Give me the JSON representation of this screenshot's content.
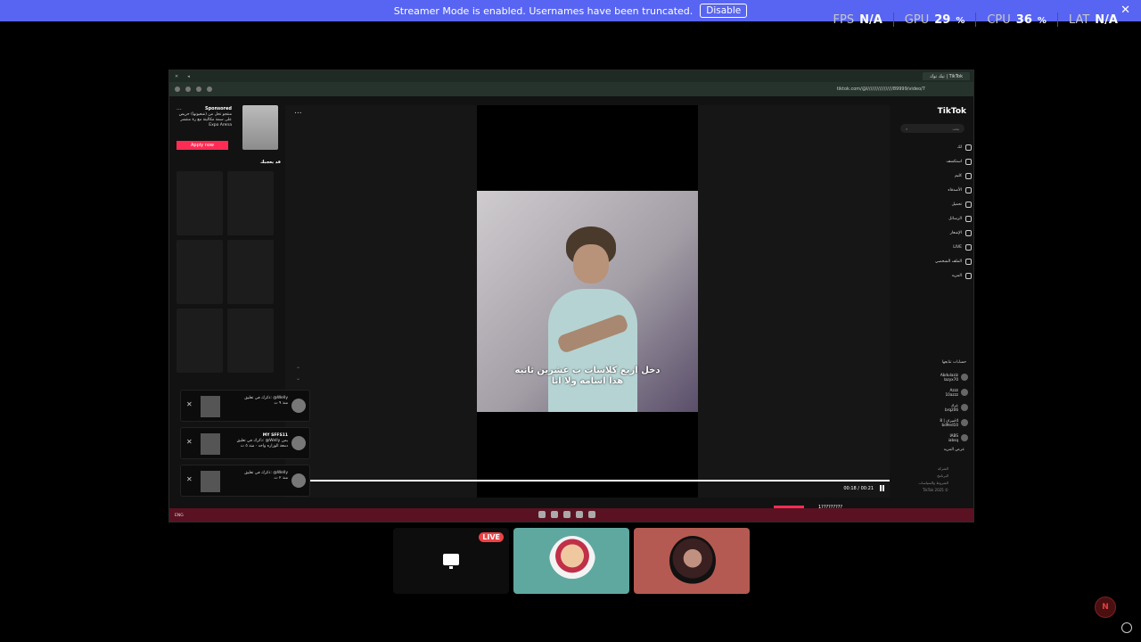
{
  "banner": {
    "message": "Streamer Mode is enabled. Usernames have been truncated.",
    "disable_label": "Disable",
    "close_label": "✕"
  },
  "stats": {
    "fps_label": "FPS",
    "fps_value": "N/A",
    "gpu_label": "GPU",
    "gpu_value": "29",
    "cpu_label": "CPU",
    "cpu_value": "36",
    "lat_label": "LAT",
    "lat_value": "N/A",
    "pct": "%"
  },
  "browser": {
    "tab_title": "تيك توك | TikTok",
    "url": "tiktok.com/@l/////////////////89999/video/7"
  },
  "ad": {
    "more": "...",
    "sponsored": "Sponsored",
    "text": "منتجو تحل من (شعبونها) حريص على سمة مكاليتة مع رة منتشر",
    "brand": "Expo Arena",
    "apply": "Apply now",
    "section": "قد يعجبك"
  },
  "video": {
    "more": "...",
    "subtitle_line1": "دخل اربع كلاسات ب عشرين ثانيه",
    "subtitle_line2": "هذا اسامه ولا انا",
    "time": "00:18 / 00:21",
    "progress": 1.0
  },
  "tiktok": {
    "logo": "TikTok",
    "search_placeholder": "بحث",
    "nav": [
      "لك",
      "استكشف",
      "كليم",
      "الأصدقاء",
      "تحميل",
      "الرسائل",
      "الإشعار",
      "LIVE",
      "الملف الشخصي",
      "المزيد"
    ],
    "following_title": "حسابات تتابعها",
    "accounts": [
      {
        "name": "Abdulaziz",
        "handle": "lazyx70"
      },
      {
        "name": "Azzz",
        "handle": "10azzz"
      },
      {
        "name": "عزك",
        "handle": "brq206"
      },
      {
        "name": "ميزان | 8id",
        "handle": "bd9ed10"
      },
      {
        "name": "IABS",
        "handle": "iabsq"
      }
    ],
    "show_more": "عرض المزيد",
    "footer": [
      "الشركة",
      "البرنامج",
      "الشروط والسياسات",
      "TikTok 2025 ©"
    ]
  },
  "notifications": [
    {
      "head": "",
      "line1": "ذكرك في تعليق: @Welly",
      "line2": "منذ ٩ ث"
    },
    {
      "head": "MY SFFS11",
      "line1": "ذكرك في تعليق: @Welly يمن",
      "line2": "دمعة الوزاره واحد · منذ ٥ ث"
    },
    {
      "head": "",
      "line1": "ذكرك في تعليق: @Welly",
      "line2": "منذ ٢ ث"
    }
  ],
  "taskbar": {
    "left": "ENG",
    "comment_text": "1?????????"
  },
  "call": {
    "live_badge": "LIVE"
  }
}
